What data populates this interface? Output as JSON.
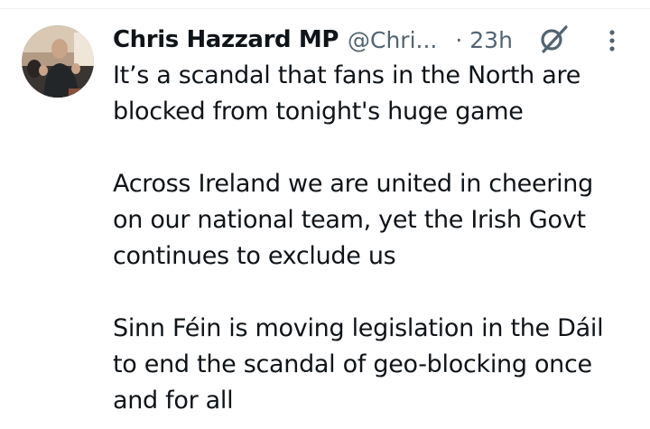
{
  "tweet": {
    "author_name": "Chris Hazzard MP",
    "handle": "@Chri...",
    "time": "· 23h",
    "paragraphs": [
      [
        "It’s a scandal that fans in the North are",
        "blocked from tonight's huge game"
      ],
      [
        "Across Ireland we are united in cheering",
        "on our national team, yet the Irish Govt",
        "continues to exclude us"
      ],
      [
        "Sinn Féin is moving legislation in the Dáil",
        "to end the scandal of geo-blocking once",
        "and for all"
      ]
    ],
    "icons": {
      "grok": "grok-icon",
      "more": "more-options-icon"
    },
    "colors": {
      "text": "#0f1419",
      "secondary": "#536471",
      "divider": "#eff3f4"
    }
  }
}
